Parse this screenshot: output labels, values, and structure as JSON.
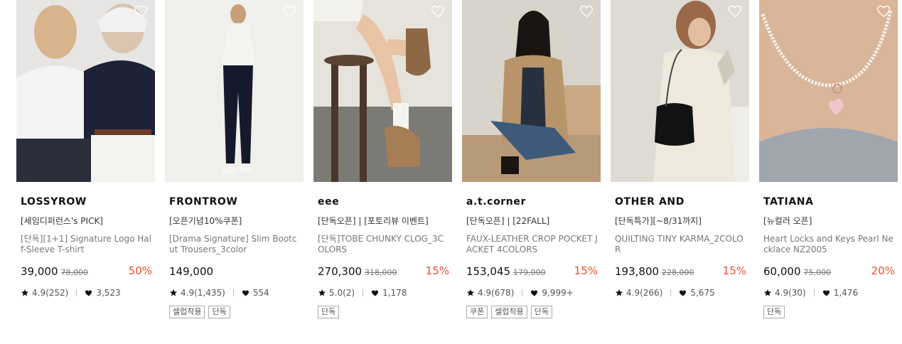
{
  "colors": {
    "discount": "#e8512c",
    "brand_text": "#111111",
    "muted_text": "#777777"
  },
  "products": [
    {
      "brand": "LOSSYROW",
      "promo": "[세임디퍼런스's PICK]",
      "name": "[단독][1+1] Signature Logo Half-Sleeve T-shirt",
      "price": "39,000",
      "original_price": "78,000",
      "discount": "50%",
      "rating": "4.9(252)",
      "likes": "3,523",
      "tags": [],
      "image": "two-models-tshirts-photo"
    },
    {
      "brand": "FRONTROW",
      "promo": "[오픈기념10%쿠폰]",
      "name": "[Drama Signature] Slim Bootcut Trousers_3color",
      "price": "149,000",
      "original_price": "",
      "discount": "",
      "rating": "4.9(1,435)",
      "likes": "554",
      "tags": [
        "셀럽착용",
        "단독"
      ],
      "image": "model-black-trousers-photo"
    },
    {
      "brand": "eee",
      "promo": "[단독오픈] | [포토리뷰 이벤트]",
      "name": "[단독]TOBE CHUNKY CLOG_3COLORS",
      "price": "270,300",
      "original_price": "318,000",
      "discount": "15%",
      "rating": "5.0(2)",
      "likes": "1,178",
      "tags": [
        "단독"
      ],
      "image": "chunky-clog-legs-photo"
    },
    {
      "brand": "a.t.corner",
      "promo": "[단독오픈] | [22FALL]",
      "name": "FAUX-LEATHER CROP POCKET JACKET 4COLORS",
      "price": "153,045",
      "original_price": "179,000",
      "discount": "15%",
      "rating": "4.9(678)",
      "likes": "9,999+",
      "tags": [
        "쿠폰",
        "셀럽착용",
        "단독"
      ],
      "image": "model-leather-jacket-photo"
    },
    {
      "brand": "OTHER AND",
      "promo": "[단독특가][~8/31까지]",
      "name": "QUILTING TINY KARMA_2COLOR",
      "price": "193,800",
      "original_price": "228,000",
      "discount": "15%",
      "rating": "4.9(266)",
      "likes": "5,675",
      "tags": [],
      "image": "quilted-bag-model-photo"
    },
    {
      "brand": "TATIANA",
      "promo": "[뉴컬러 오픈]",
      "name": "Heart Locks and Keys Pearl Necklace NZ2005",
      "price": "60,000",
      "original_price": "75,000",
      "discount": "20%",
      "rating": "4.9(30)",
      "likes": "1,476",
      "tags": [
        "단독"
      ],
      "image": "pearl-necklace-photo"
    }
  ]
}
